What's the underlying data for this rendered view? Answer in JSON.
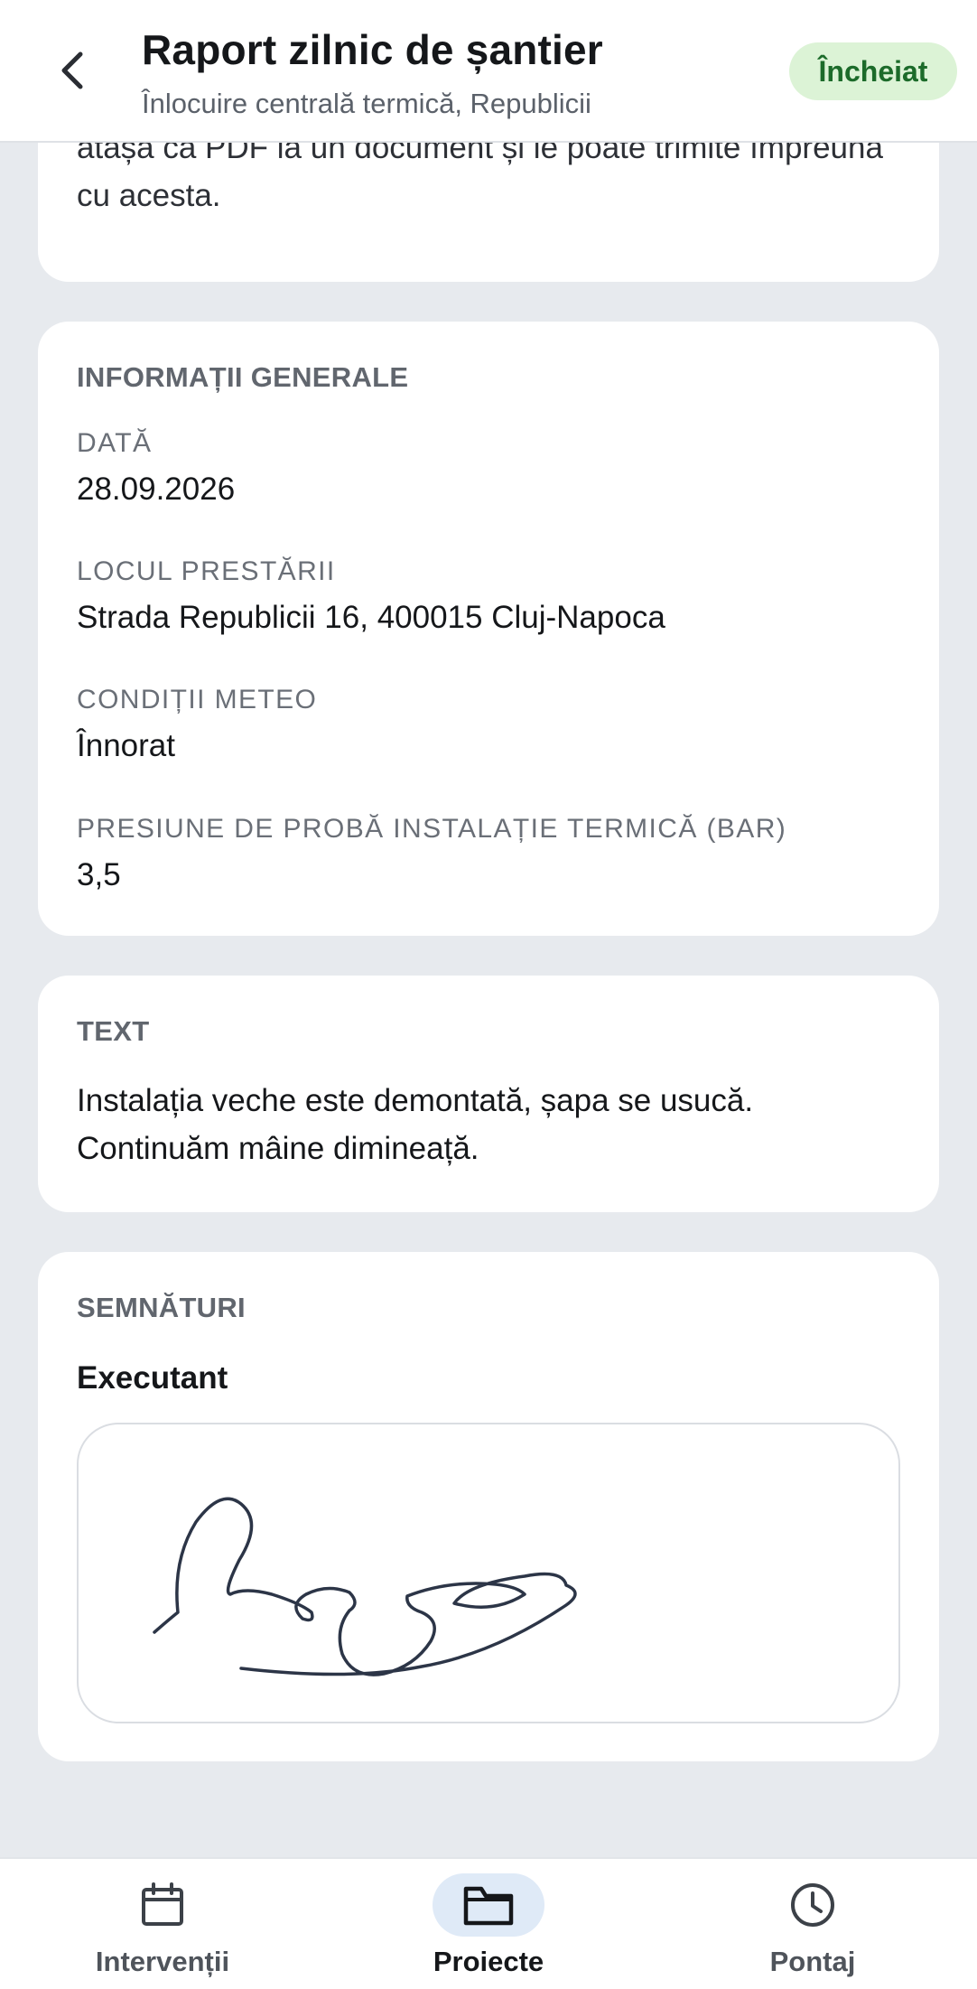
{
  "header": {
    "title": "Raport zilnic de șantier",
    "subtitle": "Înlocuire centrală termică, Republicii",
    "status": "Încheiat",
    "back_icon": "chevron-left-icon"
  },
  "intro_card": {
    "text": "birou le găsești în proiect, la „Rapoarte”, iar biroul le poate atașa ca PDF la un document și le poate trimite împreună cu acesta."
  },
  "general_info": {
    "section_title": "INFORMAȚII GENERALE",
    "fields": [
      {
        "label": "DATĂ",
        "value": "28.09.2026"
      },
      {
        "label": "LOCUL PRESTĂRII",
        "value": "Strada Republicii 16, 400015 Cluj-Napoca"
      },
      {
        "label": "CONDIȚII METEO",
        "value": "Înnorat"
      },
      {
        "label": "PRESIUNE DE PROBĂ INSTALAȚIE TERMICĂ (BAR)",
        "value": "3,5"
      }
    ]
  },
  "text_section": {
    "section_title": "TEXT",
    "body": "Instalația veche este demontată, șapa se usucă. Continuăm mâine dimineață."
  },
  "signatures": {
    "section_title": "SEMNĂTURI",
    "signer_label": "Executant"
  },
  "bottom_nav": {
    "items": [
      {
        "label": "Intervenții",
        "icon": "calendar-icon",
        "active": false
      },
      {
        "label": "Proiecte",
        "icon": "folder-icon",
        "active": true
      },
      {
        "label": "Pontaj",
        "icon": "clock-icon",
        "active": false
      }
    ]
  },
  "colors": {
    "background": "#e7eaee",
    "status_bg": "#dcf3d6",
    "status_text": "#1c6b2a",
    "nav_active_bg": "#dfeaf7"
  }
}
